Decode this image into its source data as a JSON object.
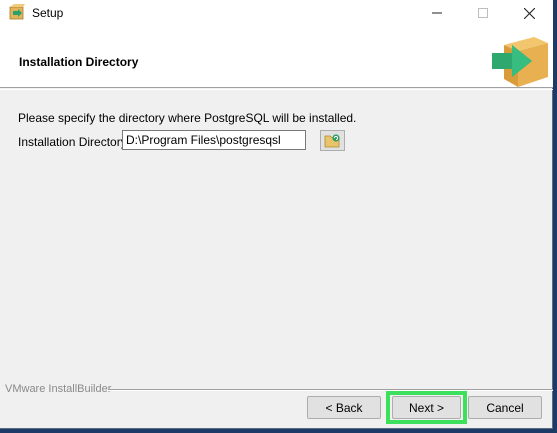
{
  "window": {
    "title": "Setup",
    "icon": "setup-app-icon",
    "controls": {
      "minimize": "minimize-icon",
      "maximize": "maximize-icon",
      "close": "close-icon"
    }
  },
  "header": {
    "title": "Installation Directory",
    "graphic": "package-box-icon"
  },
  "body": {
    "instruction": "Please specify the directory where PostgreSQL will be installed.",
    "directory_label": "Installation Directory",
    "directory_value": "D:\\Program Files\\postgresqsl",
    "browse_icon": "folder-browse-icon"
  },
  "footer": {
    "brand": "VMware InstallBuilder",
    "back_label": "< Back",
    "next_label": "Next >",
    "cancel_label": "Cancel",
    "highlight_color": "#3ce05c"
  }
}
